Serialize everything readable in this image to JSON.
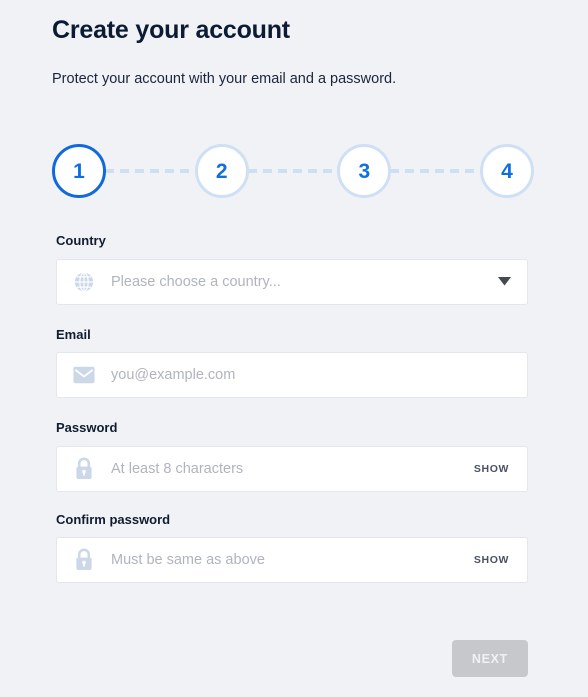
{
  "header": {
    "title": "Create your account",
    "subtitle": "Protect your account with your email and a password."
  },
  "stepper": {
    "current_step": 1,
    "steps": [
      {
        "number": "1",
        "state": "active"
      },
      {
        "number": "2",
        "state": "inactive"
      },
      {
        "number": "3",
        "state": "inactive"
      },
      {
        "number": "4",
        "state": "inactive"
      }
    ]
  },
  "form": {
    "country": {
      "label": "Country",
      "placeholder": "Please choose a country...",
      "value": "",
      "icon": "globe-icon",
      "dropdown_icon": "chevron-down-icon"
    },
    "email": {
      "label": "Email",
      "placeholder": "you@example.com",
      "value": "",
      "icon": "envelope-icon"
    },
    "password": {
      "label": "Password",
      "placeholder": "At least 8 characters",
      "value": "",
      "icon": "lock-icon",
      "toggle_label": "SHOW"
    },
    "confirm_password": {
      "label": "Confirm password",
      "placeholder": "Must be same as above",
      "value": "",
      "icon": "lock-icon",
      "toggle_label": "SHOW"
    }
  },
  "footer": {
    "next_label": "NEXT",
    "next_enabled": false
  },
  "colors": {
    "background": "#f1f2f6",
    "accent_blue": "#0f6fe0",
    "active_step_border": "#1169db",
    "inactive_step_border": "#cfe0f5",
    "connector": "#cfdff2",
    "field_border": "#e3e6ec",
    "placeholder": "#b0b4bd",
    "icon_grey": "#c8d2e0",
    "button_disabled": "#c6c8cc",
    "text_dark": "#0b1b33"
  }
}
